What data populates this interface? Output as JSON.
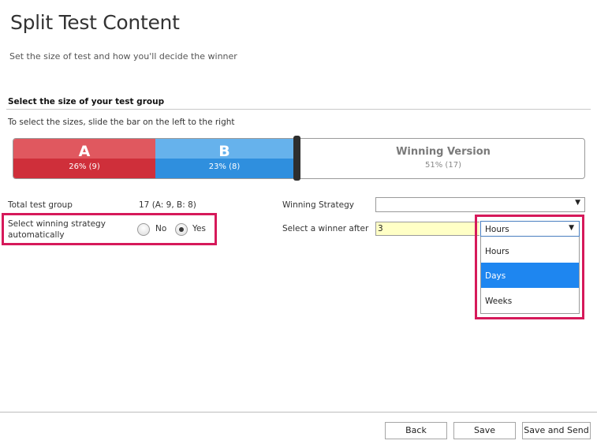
{
  "page": {
    "title": "Split Test Content",
    "subtitle": "Set the size of test and how you'll decide the winner"
  },
  "size_section": {
    "title": "Select the size of your test group",
    "instruction": "To select the sizes, slide the bar on the left to the right",
    "version_a": {
      "label": "A",
      "percent_text": "26% (9)",
      "percent": 26,
      "color": "#d9363e"
    },
    "version_b": {
      "label": "B",
      "percent_text": "23% (8)",
      "percent": 23,
      "color": "#3b97e3"
    },
    "winning": {
      "label": "Winning Version",
      "percent_text": "51% (17)",
      "percent": 51
    }
  },
  "total_group": {
    "label": "Total test group",
    "value": "17 (A: 9, B: 8)"
  },
  "auto_strategy": {
    "label": "Select winning strategy automatically",
    "options": [
      {
        "label": "No",
        "checked": false
      },
      {
        "label": "Yes",
        "checked": true
      }
    ]
  },
  "winning_strategy": {
    "label": "Winning Strategy",
    "value": ""
  },
  "select_winner": {
    "label": "Select a winner after",
    "value": "3",
    "unit_selected": "Hours",
    "unit_options": [
      "Hours",
      "Days",
      "Weeks"
    ],
    "highlighted_option": "Days"
  },
  "footer": {
    "back_label": "Back",
    "save_label": "Save",
    "save_send_label": "Save and Send"
  },
  "colors": {
    "highlight_border": "#d6195a",
    "input_highlight": "#ffffc6",
    "dropdown_selected": "#1e86f0"
  }
}
